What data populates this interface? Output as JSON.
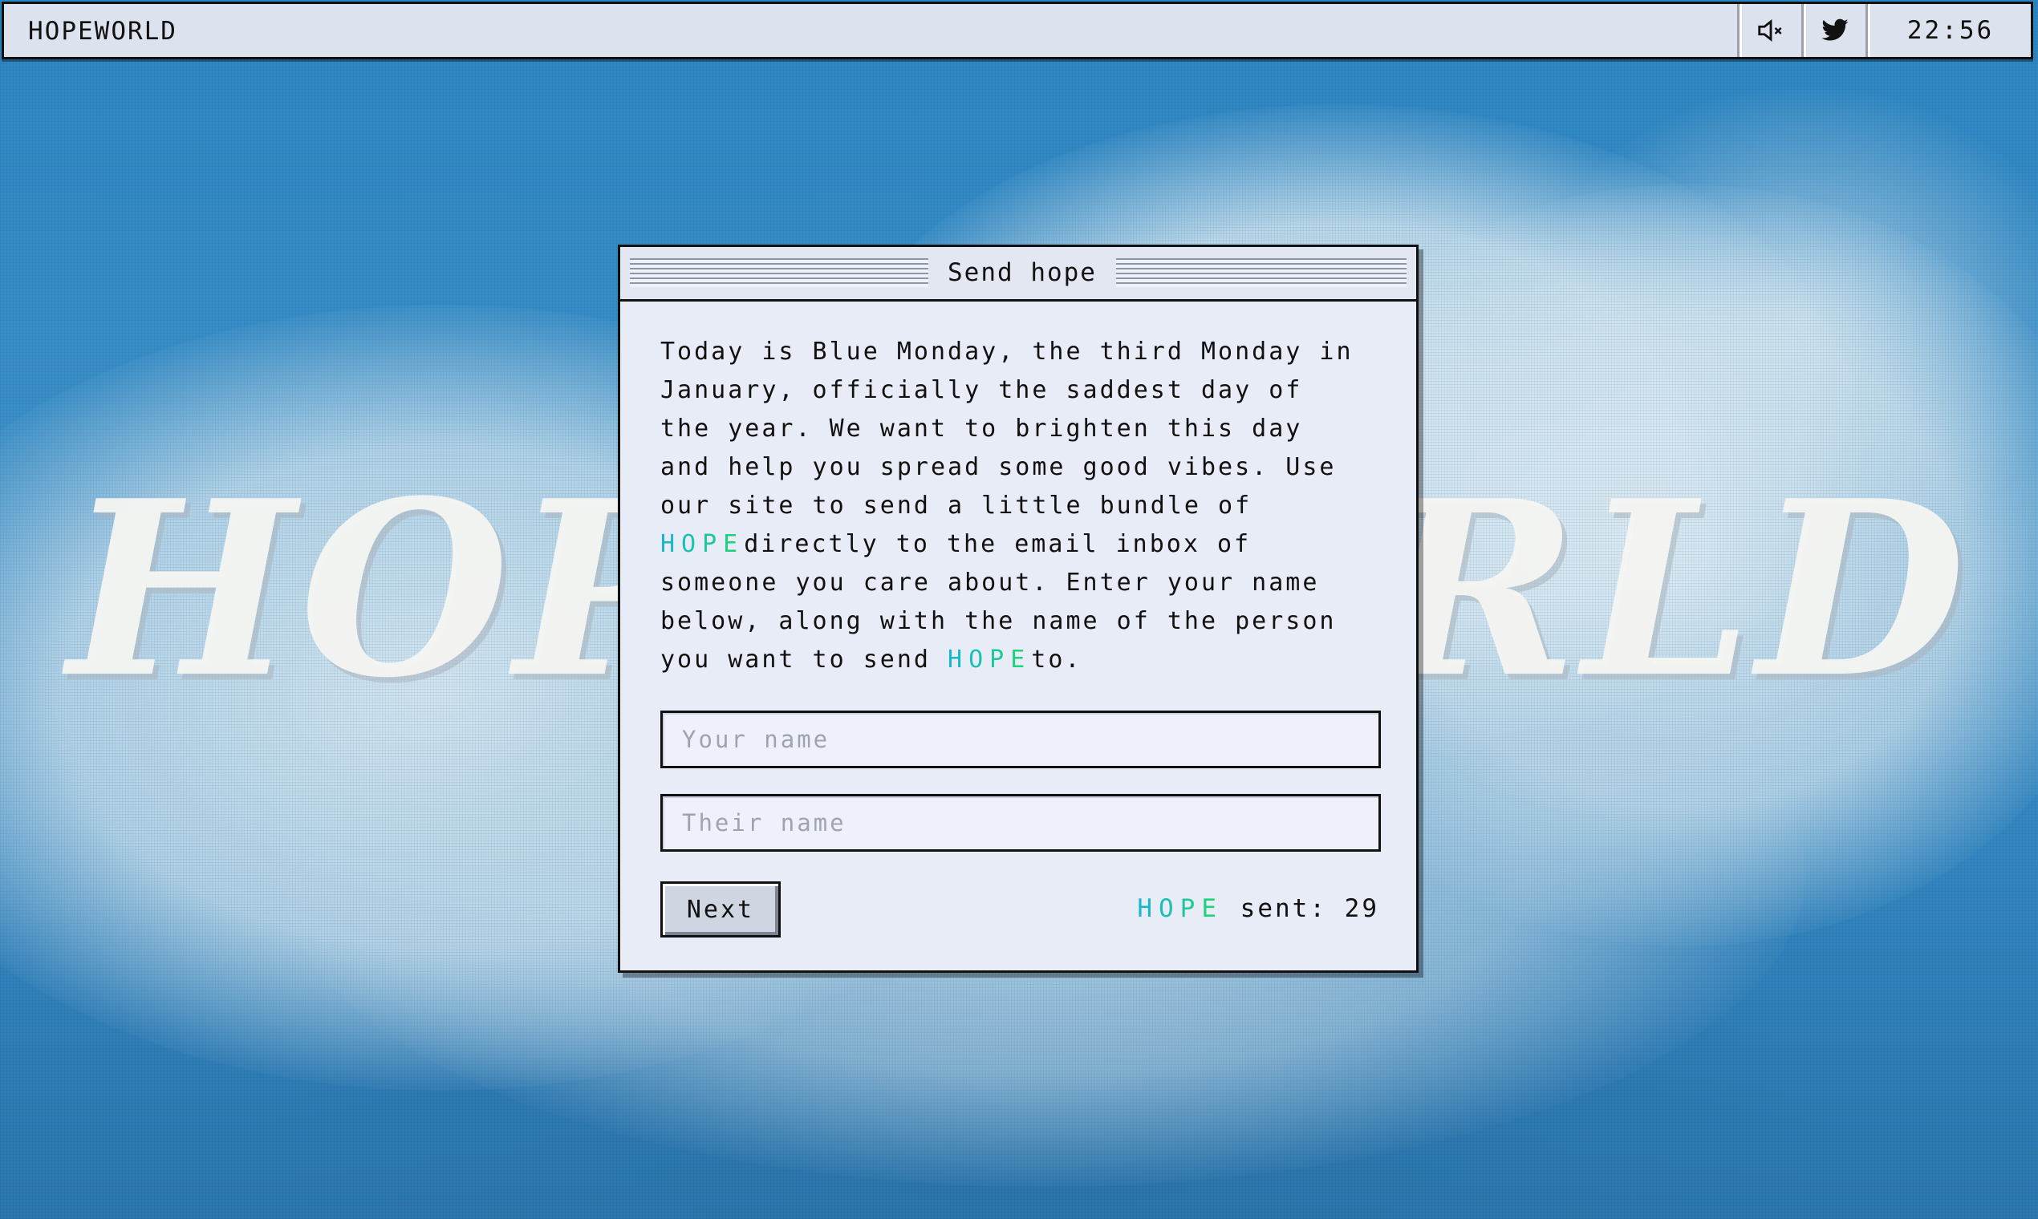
{
  "menubar": {
    "app_title": "HOPEWORLD",
    "mute_icon": "speaker-muted-icon",
    "twitter_icon": "twitter-bird-icon",
    "clock": "22:56"
  },
  "background": {
    "watermark": "HOPEWORLD",
    "sky_color": "#2f83bd"
  },
  "dialog": {
    "title": "Send hope",
    "body": {
      "part1": "Today is Blue Monday, the third Monday in January, officially the saddest day of the year. We want to brighten this day and help you spread some good vibes. Use our site to send a little bundle of ",
      "hope1": "HOPE",
      "part2": "directly to the email inbox of someone you care about. Enter your name below, along with the name of the person you want to send ",
      "hope2": "HOPE",
      "part3": "to."
    },
    "your_name_placeholder": "Your name",
    "their_name_placeholder": "Their name",
    "next_label": "Next",
    "sent": {
      "hope": "HOPE",
      "label": " sent: ",
      "count": "29"
    }
  },
  "colors": {
    "hope_gradient_start": "#16b4d4",
    "hope_gradient_end": "#1fd76a",
    "window_bg": "#e8ecf7"
  }
}
